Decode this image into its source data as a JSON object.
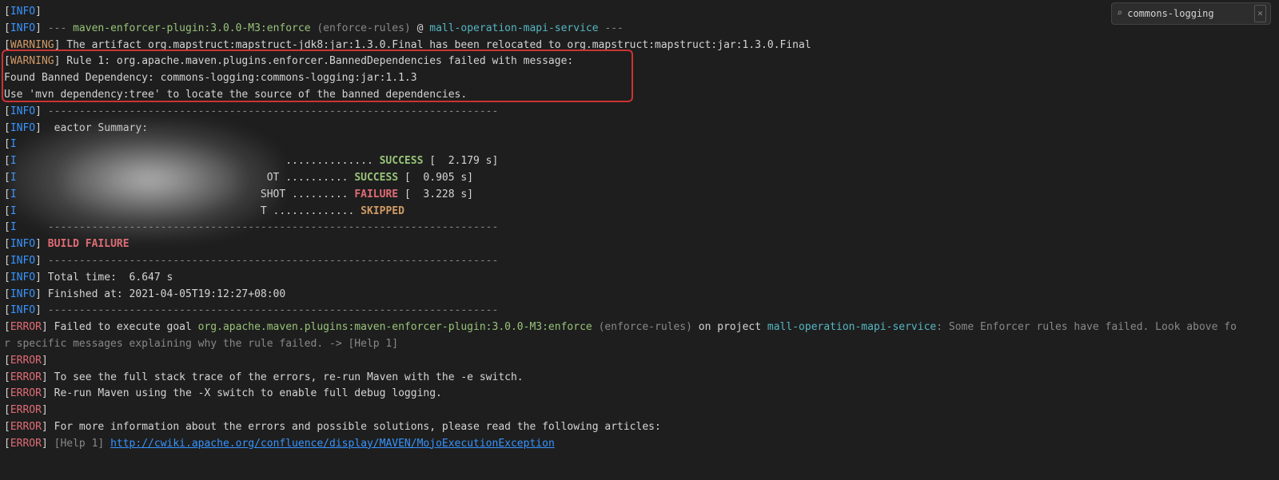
{
  "search": {
    "value": "commons-logging"
  },
  "log": {
    "l1_info": "INFO",
    "l2_info": "INFO",
    "l2_dash": "---",
    "l2_plugin": "maven-enforcer-plugin:3.0.0-M3:enforce",
    "l2_rules": "(enforce-rules)",
    "l2_at": "@",
    "l2_svc": "mall-operation-mapi-service",
    "l2_dash2": "---",
    "l3_warn": "WARNING",
    "l3_txt": "The artifact org.mapstruct:mapstruct-jdk8:jar:1.3.0.Final has been relocated to org.mapstruct:mapstruct:jar:1.3.0.Final",
    "l4_warn": "WARNING",
    "l4_txt": "Rule 1: org.apache.maven.plugins.enforcer.BannedDependencies failed with message:",
    "l5_txt": "Found Banned Dependency: commons-logging:commons-logging:jar:1.1.3",
    "l6_txt": "Use 'mvn dependency:tree' to locate the source of the banned dependencies.",
    "l7_info": "INFO",
    "l7_sep": "------------------------------------------------------------------------",
    "l8_info": "INFO",
    "l8_txt": "eactor Summary:",
    "l9_info": "I",
    "l10_info": "I",
    "l10_dots": "..............",
    "l10_success": "SUCCESS",
    "l10_time": "[  2.179 s]",
    "l11_info": "I",
    "l11_pre": "OT ..........",
    "l11_success": "SUCCESS",
    "l11_time": "[  0.905 s]",
    "l12_info": "I",
    "l12_pre": "SHOT .........",
    "l12_failure": "FAILURE",
    "l12_time": "[  3.228 s]",
    "l13_info": "I",
    "l13_pre": "T .............",
    "l13_skipped": "SKIPPED",
    "l14_info": "I",
    "l14_sep": "------------------------------------------------------------------------",
    "l15_info": "INFO",
    "l15_bf": "BUILD FAILURE",
    "l16_info": "INFO",
    "l16_sep": "------------------------------------------------------------------------",
    "l17_info": "INFO",
    "l17_txt": "Total time:  6.647 s",
    "l18_info": "INFO",
    "l18_txt": "Finished at: 2021-04-05T19:12:27+08:00",
    "l19_info": "INFO",
    "l19_sep": "------------------------------------------------------------------------",
    "l20_err": "ERROR",
    "l20_a": "Failed to execute goal",
    "l20_b": "org.apache.maven.plugins:maven-enforcer-plugin:3.0.0-M3:enforce",
    "l20_c": "(enforce-rules)",
    "l20_d": "on project",
    "l20_e": "mall-operation-mapi-service",
    "l20_f": ": Some Enforcer rules have failed. Look above fo",
    "l21_txt": "r specific messages explaining why the rule failed. -> [Help 1]",
    "l22_err": "ERROR",
    "l23_err": "ERROR",
    "l23_txt": "To see the full stack trace of the errors, re-run Maven with the -e switch.",
    "l24_err": "ERROR",
    "l24_txt": "Re-run Maven using the -X switch to enable full debug logging.",
    "l25_err": "ERROR",
    "l26_err": "ERROR",
    "l26_txt": "For more information about the errors and possible solutions, please read the following articles:",
    "l27_err": "ERROR",
    "l27_help": "[Help 1]",
    "l27_link": "http://cwiki.apache.org/confluence/display/MAVEN/MojoExecutionException"
  }
}
